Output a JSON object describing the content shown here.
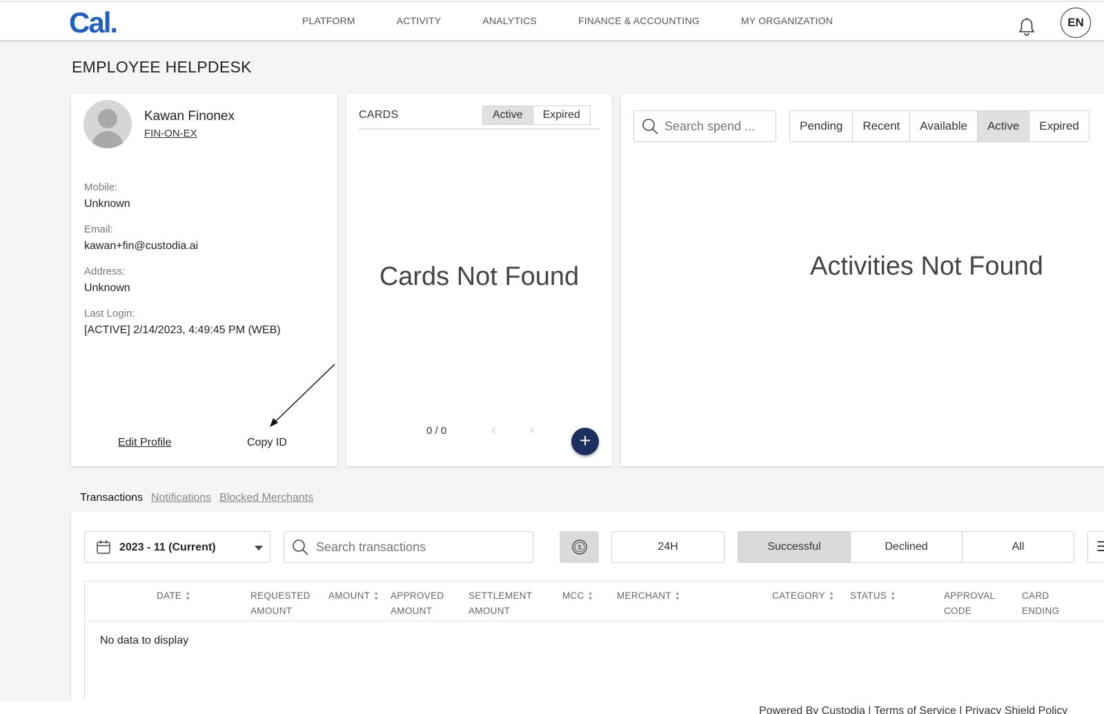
{
  "header": {
    "logo": "Cal.",
    "nav": [
      "PLATFORM",
      "ACTIVITY",
      "ANALYTICS",
      "FINANCE & ACCOUNTING",
      "MY ORGANIZATION"
    ],
    "language": "EN"
  },
  "page_title": "EMPLOYEE HELPDESK",
  "profile": {
    "name": "Kawan Finonex",
    "org": "FIN-ON-EX",
    "mobile_label": "Mobile:",
    "mobile": "Unknown",
    "email_label": "Email:",
    "email": "kawan+fin@custodia.ai",
    "address_label": "Address:",
    "address": "Unknown",
    "last_login_label": "Last Login:",
    "last_login": "[ACTIVE] 2/14/2023, 4:49:45 PM (WEB)",
    "edit_label": "Edit Profile",
    "copy_label": "Copy ID"
  },
  "cards": {
    "title": "CARDS",
    "filters": [
      "Active",
      "Expired"
    ],
    "active_filter": "Active",
    "empty": "Cards Not Found",
    "pager": "0 / 0",
    "prev": "‹",
    "next": "›",
    "add": "+"
  },
  "activities": {
    "search_placeholder": "Search spend ...",
    "filters": [
      "Pending",
      "Recent",
      "Available",
      "Active",
      "Expired"
    ],
    "active_filter": "Active",
    "empty": "Activities Not Found"
  },
  "tabs": [
    "Transactions",
    "Notifications",
    "Blocked Merchants"
  ],
  "active_tab": "Transactions",
  "transactions": {
    "period": "2023 - 11 (Current)",
    "search_placeholder": "Search transactions",
    "range": "24H",
    "status_filters": [
      "Successful",
      "Declined",
      "All"
    ],
    "active_status": "Successful",
    "menu_icon": "☰",
    "columns": [
      {
        "line1": "DATE",
        "line2": ""
      },
      {
        "line1": "REQUESTED",
        "line2": "AMOUNT"
      },
      {
        "line1": "AMOUNT",
        "line2": ""
      },
      {
        "line1": "APPROVED",
        "line2": "AMOUNT"
      },
      {
        "line1": "SETTLEMENT",
        "line2": "AMOUNT"
      },
      {
        "line1": "MCC",
        "line2": ""
      },
      {
        "line1": "MERCHANT",
        "line2": ""
      },
      {
        "line1": "CATEGORY",
        "line2": ""
      },
      {
        "line1": "STATUS",
        "line2": ""
      },
      {
        "line1": "APPROVAL",
        "line2": "CODE"
      },
      {
        "line1": "CARD",
        "line2": "ENDING"
      }
    ],
    "empty": "No data to display"
  },
  "footer": "Powered By Custodia | Terms of Service | Privacy Shield Policy",
  "icons": {
    "bell": "bell-icon",
    "search": "search-icon",
    "calendar": "calendar-icon",
    "coin": "dollar-coin-icon",
    "sort": "sort-icon",
    "menu": "menu-icon"
  },
  "colors": {
    "brand": "#1f5fbf",
    "add_button": "#1d2f5e",
    "selected_segment": "#e0e0e0"
  }
}
